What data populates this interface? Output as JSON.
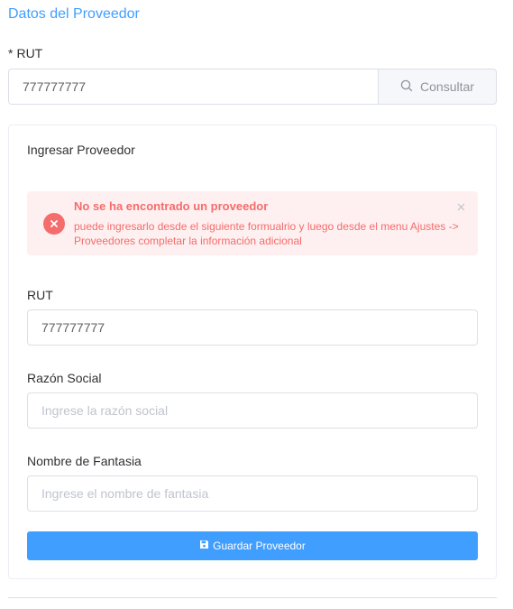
{
  "section": {
    "title": "Datos del Proveedor"
  },
  "search": {
    "required_mark": "*",
    "label": "RUT",
    "value": "777777777",
    "button_label": "Consultar",
    "button_icon": "search-icon"
  },
  "card": {
    "title": "Ingresar Proveedor",
    "alert": {
      "title": "No se ha encontrado un proveedor",
      "description": "puede ingresarlo desde el siguiente formualrio y luego desde el menu Ajustes -> Proveedores completar la información adicional",
      "icon": "error-circle-icon",
      "close_icon": "close-icon",
      "color": "#f56c6c",
      "background": "#fef0f0"
    },
    "fields": {
      "rut": {
        "label": "RUT",
        "value": "777777777",
        "placeholder": ""
      },
      "razon_social": {
        "label": "Razón Social",
        "value": "",
        "placeholder": "Ingrese la razón social"
      },
      "nombre_fantasia": {
        "label": "Nombre de Fantasia",
        "value": "",
        "placeholder": "Ingrese el nombre de fantasia"
      }
    },
    "save_button": {
      "label": "Guardar Proveedor",
      "icon": "save-icon"
    }
  },
  "colors": {
    "accent": "#409eff",
    "danger": "#f56c6c",
    "border": "#dcdfe6"
  }
}
